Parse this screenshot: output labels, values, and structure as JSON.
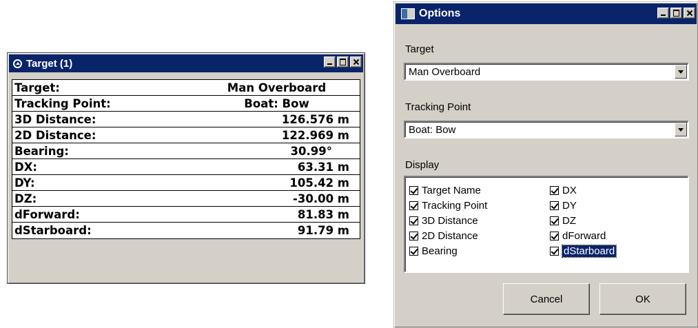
{
  "target_window": {
    "title": "Target (1)",
    "rows": [
      {
        "label": "Target:",
        "value": "Man Overboard"
      },
      {
        "label": "Tracking Point:",
        "value": "Boat: Bow"
      },
      {
        "label": "3D Distance:",
        "value": "126.576 m"
      },
      {
        "label": "2D Distance:",
        "value": "122.969 m"
      },
      {
        "label": "Bearing:",
        "value": "30.99°"
      },
      {
        "label": "DX:",
        "value": "63.31 m"
      },
      {
        "label": "DY:",
        "value": "105.42 m"
      },
      {
        "label": "DZ:",
        "value": "-30.00 m"
      },
      {
        "label": "dForward:",
        "value": "81.83 m"
      },
      {
        "label": "dStarboard:",
        "value": "91.79 m"
      }
    ]
  },
  "options_window": {
    "title": "Options",
    "target_label": "Target",
    "target_value": "Man Overboard",
    "tracking_label": "Tracking Point",
    "tracking_value": "Boat: Bow",
    "display_label": "Display",
    "display_left": [
      {
        "label": "Target Name",
        "checked": true
      },
      {
        "label": "Tracking Point",
        "checked": true
      },
      {
        "label": "3D Distance",
        "checked": true
      },
      {
        "label": "2D Distance",
        "checked": true
      },
      {
        "label": "Bearing",
        "checked": true
      }
    ],
    "display_right": [
      {
        "label": "DX",
        "checked": true
      },
      {
        "label": "DY",
        "checked": true
      },
      {
        "label": "DZ",
        "checked": true
      },
      {
        "label": "dForward",
        "checked": true
      },
      {
        "label": "dStarboard",
        "checked": true
      }
    ],
    "cancel_label": "Cancel",
    "ok_label": "OK"
  },
  "colors": {
    "titlebar": "#0a246a",
    "window_face": "#d4d0c8",
    "selection": "#0a246a"
  }
}
